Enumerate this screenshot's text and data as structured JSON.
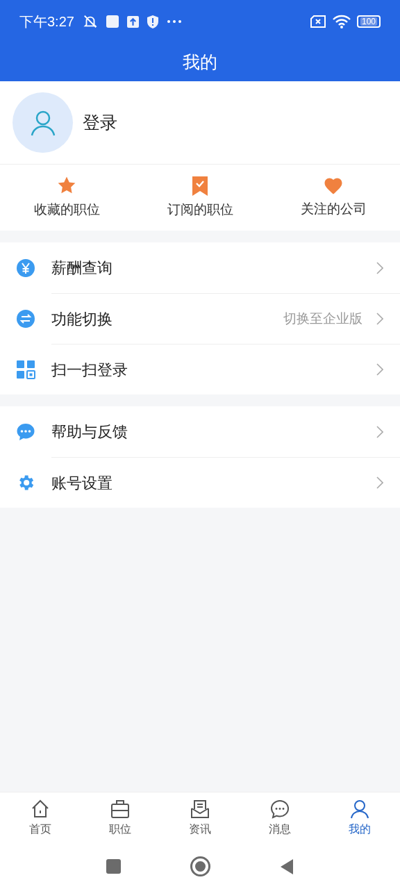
{
  "status_bar": {
    "time": "下午3:27",
    "battery": "100"
  },
  "header": {
    "title": "我的"
  },
  "profile": {
    "login_label": "登录"
  },
  "quick_links": [
    {
      "label": "收藏的职位"
    },
    {
      "label": "订阅的职位"
    },
    {
      "label": "关注的公司"
    }
  ],
  "menu_groups": [
    {
      "items": [
        {
          "label": "薪酬查询"
        },
        {
          "label": "功能切换",
          "value": "切换至企业版"
        },
        {
          "label": "扫一扫登录"
        }
      ]
    },
    {
      "items": [
        {
          "label": "帮助与反馈"
        },
        {
          "label": "账号设置"
        }
      ]
    }
  ],
  "bottom_nav": [
    {
      "label": "首页",
      "selected": false
    },
    {
      "label": "职位",
      "selected": false
    },
    {
      "label": "资讯",
      "selected": false
    },
    {
      "label": "消息",
      "selected": false
    },
    {
      "label": "我的",
      "selected": true
    }
  ]
}
